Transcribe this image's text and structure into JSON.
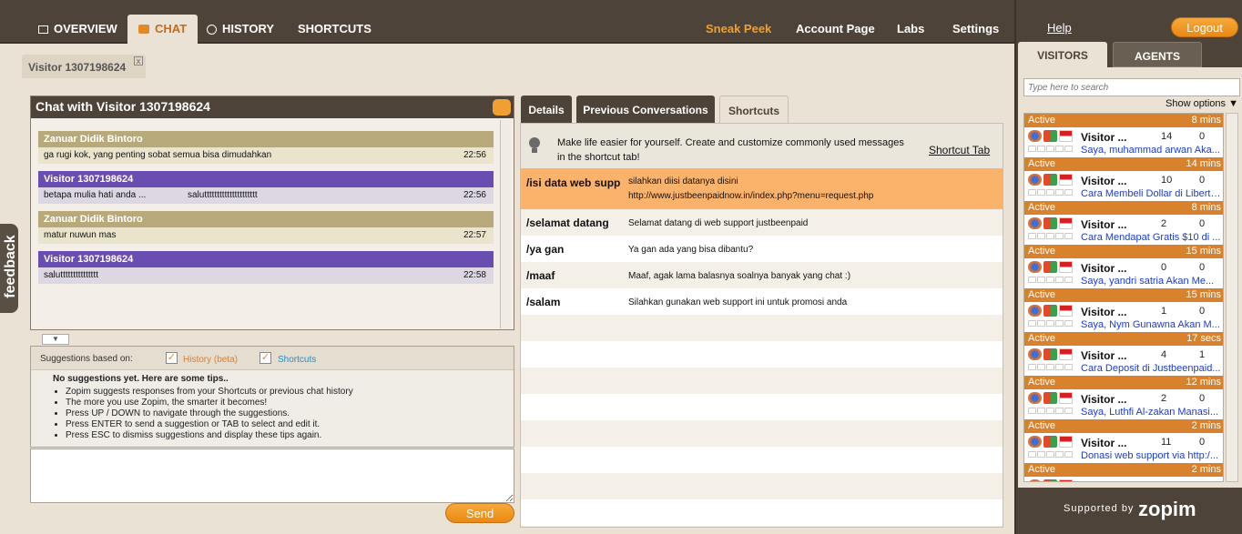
{
  "nav": {
    "tabs": [
      {
        "label": "OVERVIEW",
        "icon": "overview-icon"
      },
      {
        "label": "CHAT",
        "icon": "chat-bubble-icon"
      },
      {
        "label": "HISTORY",
        "icon": "clock-icon"
      },
      {
        "label": "SHORTCUTS",
        "icon": ""
      }
    ],
    "right_links": [
      "Sneak Peek",
      "Account Page",
      "Labs",
      "Settings"
    ]
  },
  "right": {
    "help": "Help",
    "logout": "Logout",
    "tabs": [
      "VISITORS",
      "AGENTS"
    ],
    "search_placeholder": "Type here to search",
    "show_options": "Show options ▼",
    "supported_by": "Supported by",
    "brand": "zopim",
    "visitors": [
      {
        "status": "Active",
        "time": "8 mins",
        "name": "Visitor ...",
        "count": "14",
        "msgs": "0",
        "sub": "Saya, muhammad arwan Aka..."
      },
      {
        "status": "Active",
        "time": "14 mins",
        "name": "Visitor ...",
        "count": "10",
        "msgs": "0",
        "sub": "Cara Membeli Dollar di Liberty..."
      },
      {
        "status": "Active",
        "time": "8 mins",
        "name": "Visitor ...",
        "count": "2",
        "msgs": "0",
        "sub": "Cara Mendapat Gratis $10 di ..."
      },
      {
        "status": "Active",
        "time": "15 mins",
        "name": "Visitor ...",
        "count": "0",
        "msgs": "0",
        "sub": "Saya, yandri satria Akan Me..."
      },
      {
        "status": "Active",
        "time": "15 mins",
        "name": "Visitor ...",
        "count": "1",
        "msgs": "0",
        "sub": "Saya, Nym Gunawna Akan M..."
      },
      {
        "status": "Active",
        "time": "17 secs",
        "name": "Visitor ...",
        "count": "4",
        "msgs": "1",
        "sub": "Cara Deposit di Justbeenpaid..."
      },
      {
        "status": "Active",
        "time": "12 mins",
        "name": "Visitor ...",
        "count": "2",
        "msgs": "0",
        "sub": "Saya, Luthfi Al-zakan Manasi..."
      },
      {
        "status": "Active",
        "time": "2 mins",
        "name": "Visitor ...",
        "count": "11",
        "msgs": "0",
        "sub": "Donasi web support via http:/..."
      },
      {
        "status": "Active",
        "time": "2 mins",
        "name": "Visitor ...",
        "count": "",
        "msgs": "",
        "sub": ""
      }
    ]
  },
  "visitor_tab": {
    "label": "Visitor 1307198624",
    "close": "x"
  },
  "chat": {
    "title": "Chat with Visitor 1307198624",
    "messages": [
      {
        "who": "Zanuar Didik Bintoro",
        "text": "ga rugi kok, yang penting sobat semua bisa dimudahkan",
        "text2": "",
        "time": "22:56"
      },
      {
        "who": "Visitor 1307198624",
        "text": "betapa mulia hati anda ...",
        "text2": "saluttttttttttttttttttttt",
        "time": "22:56"
      },
      {
        "who": "Zanuar Didik Bintoro",
        "text": "matur nuwun mas",
        "text2": "",
        "time": "22:57"
      },
      {
        "who": "Visitor 1307198624",
        "text": "saluttttttttttttttt",
        "text2": "",
        "time": "22:58"
      }
    ]
  },
  "suggestions": {
    "label": "Suggestions based on:",
    "history": "History (beta)",
    "shortcuts": "Shortcuts",
    "title": "No suggestions yet. Here are some tips..",
    "tips": [
      "Zopim suggests responses from your Shortcuts or previous chat history",
      "The more you use Zopim, the smarter it becomes!",
      "Press UP / DOWN to navigate through the suggestions.",
      "Press ENTER to send a suggestion or TAB to select and edit it.",
      "Press ESC to dismiss suggestions and display these tips again."
    ]
  },
  "send": "Send",
  "panel_tabs": [
    "Details",
    "Previous Conversations",
    "Shortcuts"
  ],
  "shortcuts": {
    "tip": "Make life easier for yourself. Create and customize commonly used messages in the shortcut tab!",
    "link": "Shortcut Tab",
    "rows": [
      {
        "key": "/isi data web supp",
        "value": "silahkan diisi datanya disini",
        "value2": "http://www.justbeenpaidnow.in/index.php?menu=request.php"
      },
      {
        "key": "/selamat datang",
        "value": "Selamat datang di web support justbeenpaid",
        "value2": ""
      },
      {
        "key": "/ya gan",
        "value": "Ya gan ada yang bisa dibantu?",
        "value2": ""
      },
      {
        "key": "/maaf",
        "value": "Maaf, agak lama balasnya soalnya banyak yang chat :)",
        "value2": ""
      },
      {
        "key": "/salam",
        "value": "Silahkan gunakan web support ini untuk promosi anda",
        "value2": ""
      }
    ]
  },
  "feedback": "feedback",
  "colors": {
    "accent": "#e98a12",
    "header": "#4d4339",
    "visitor_msg": "#6a4db0",
    "agent_msg": "#b7a97a",
    "highlight": "#fbb26a"
  }
}
